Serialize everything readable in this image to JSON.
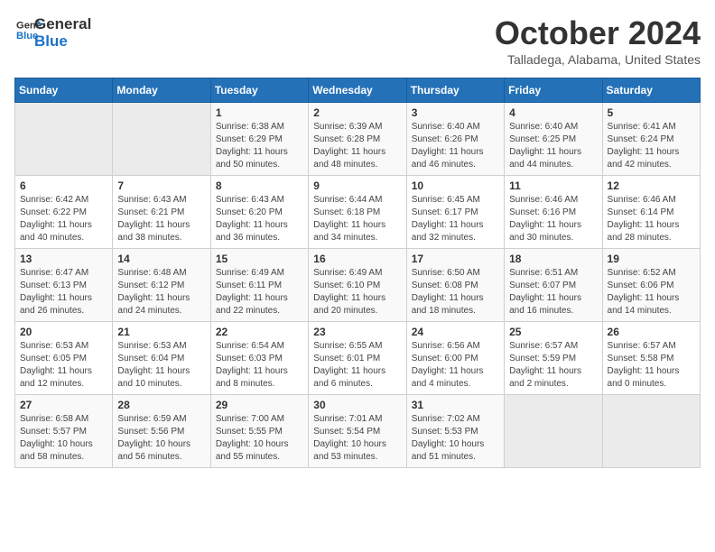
{
  "logo": {
    "line1": "General",
    "line2": "Blue"
  },
  "title": "October 2024",
  "location": "Talladega, Alabama, United States",
  "days_of_week": [
    "Sunday",
    "Monday",
    "Tuesday",
    "Wednesday",
    "Thursday",
    "Friday",
    "Saturday"
  ],
  "weeks": [
    [
      {
        "day": "",
        "sunrise": "",
        "sunset": "",
        "daylight": ""
      },
      {
        "day": "",
        "sunrise": "",
        "sunset": "",
        "daylight": ""
      },
      {
        "day": "1",
        "sunrise": "Sunrise: 6:38 AM",
        "sunset": "Sunset: 6:29 PM",
        "daylight": "Daylight: 11 hours and 50 minutes."
      },
      {
        "day": "2",
        "sunrise": "Sunrise: 6:39 AM",
        "sunset": "Sunset: 6:28 PM",
        "daylight": "Daylight: 11 hours and 48 minutes."
      },
      {
        "day": "3",
        "sunrise": "Sunrise: 6:40 AM",
        "sunset": "Sunset: 6:26 PM",
        "daylight": "Daylight: 11 hours and 46 minutes."
      },
      {
        "day": "4",
        "sunrise": "Sunrise: 6:40 AM",
        "sunset": "Sunset: 6:25 PM",
        "daylight": "Daylight: 11 hours and 44 minutes."
      },
      {
        "day": "5",
        "sunrise": "Sunrise: 6:41 AM",
        "sunset": "Sunset: 6:24 PM",
        "daylight": "Daylight: 11 hours and 42 minutes."
      }
    ],
    [
      {
        "day": "6",
        "sunrise": "Sunrise: 6:42 AM",
        "sunset": "Sunset: 6:22 PM",
        "daylight": "Daylight: 11 hours and 40 minutes."
      },
      {
        "day": "7",
        "sunrise": "Sunrise: 6:43 AM",
        "sunset": "Sunset: 6:21 PM",
        "daylight": "Daylight: 11 hours and 38 minutes."
      },
      {
        "day": "8",
        "sunrise": "Sunrise: 6:43 AM",
        "sunset": "Sunset: 6:20 PM",
        "daylight": "Daylight: 11 hours and 36 minutes."
      },
      {
        "day": "9",
        "sunrise": "Sunrise: 6:44 AM",
        "sunset": "Sunset: 6:18 PM",
        "daylight": "Daylight: 11 hours and 34 minutes."
      },
      {
        "day": "10",
        "sunrise": "Sunrise: 6:45 AM",
        "sunset": "Sunset: 6:17 PM",
        "daylight": "Daylight: 11 hours and 32 minutes."
      },
      {
        "day": "11",
        "sunrise": "Sunrise: 6:46 AM",
        "sunset": "Sunset: 6:16 PM",
        "daylight": "Daylight: 11 hours and 30 minutes."
      },
      {
        "day": "12",
        "sunrise": "Sunrise: 6:46 AM",
        "sunset": "Sunset: 6:14 PM",
        "daylight": "Daylight: 11 hours and 28 minutes."
      }
    ],
    [
      {
        "day": "13",
        "sunrise": "Sunrise: 6:47 AM",
        "sunset": "Sunset: 6:13 PM",
        "daylight": "Daylight: 11 hours and 26 minutes."
      },
      {
        "day": "14",
        "sunrise": "Sunrise: 6:48 AM",
        "sunset": "Sunset: 6:12 PM",
        "daylight": "Daylight: 11 hours and 24 minutes."
      },
      {
        "day": "15",
        "sunrise": "Sunrise: 6:49 AM",
        "sunset": "Sunset: 6:11 PM",
        "daylight": "Daylight: 11 hours and 22 minutes."
      },
      {
        "day": "16",
        "sunrise": "Sunrise: 6:49 AM",
        "sunset": "Sunset: 6:10 PM",
        "daylight": "Daylight: 11 hours and 20 minutes."
      },
      {
        "day": "17",
        "sunrise": "Sunrise: 6:50 AM",
        "sunset": "Sunset: 6:08 PM",
        "daylight": "Daylight: 11 hours and 18 minutes."
      },
      {
        "day": "18",
        "sunrise": "Sunrise: 6:51 AM",
        "sunset": "Sunset: 6:07 PM",
        "daylight": "Daylight: 11 hours and 16 minutes."
      },
      {
        "day": "19",
        "sunrise": "Sunrise: 6:52 AM",
        "sunset": "Sunset: 6:06 PM",
        "daylight": "Daylight: 11 hours and 14 minutes."
      }
    ],
    [
      {
        "day": "20",
        "sunrise": "Sunrise: 6:53 AM",
        "sunset": "Sunset: 6:05 PM",
        "daylight": "Daylight: 11 hours and 12 minutes."
      },
      {
        "day": "21",
        "sunrise": "Sunrise: 6:53 AM",
        "sunset": "Sunset: 6:04 PM",
        "daylight": "Daylight: 11 hours and 10 minutes."
      },
      {
        "day": "22",
        "sunrise": "Sunrise: 6:54 AM",
        "sunset": "Sunset: 6:03 PM",
        "daylight": "Daylight: 11 hours and 8 minutes."
      },
      {
        "day": "23",
        "sunrise": "Sunrise: 6:55 AM",
        "sunset": "Sunset: 6:01 PM",
        "daylight": "Daylight: 11 hours and 6 minutes."
      },
      {
        "day": "24",
        "sunrise": "Sunrise: 6:56 AM",
        "sunset": "Sunset: 6:00 PM",
        "daylight": "Daylight: 11 hours and 4 minutes."
      },
      {
        "day": "25",
        "sunrise": "Sunrise: 6:57 AM",
        "sunset": "Sunset: 5:59 PM",
        "daylight": "Daylight: 11 hours and 2 minutes."
      },
      {
        "day": "26",
        "sunrise": "Sunrise: 6:57 AM",
        "sunset": "Sunset: 5:58 PM",
        "daylight": "Daylight: 11 hours and 0 minutes."
      }
    ],
    [
      {
        "day": "27",
        "sunrise": "Sunrise: 6:58 AM",
        "sunset": "Sunset: 5:57 PM",
        "daylight": "Daylight: 10 hours and 58 minutes."
      },
      {
        "day": "28",
        "sunrise": "Sunrise: 6:59 AM",
        "sunset": "Sunset: 5:56 PM",
        "daylight": "Daylight: 10 hours and 56 minutes."
      },
      {
        "day": "29",
        "sunrise": "Sunrise: 7:00 AM",
        "sunset": "Sunset: 5:55 PM",
        "daylight": "Daylight: 10 hours and 55 minutes."
      },
      {
        "day": "30",
        "sunrise": "Sunrise: 7:01 AM",
        "sunset": "Sunset: 5:54 PM",
        "daylight": "Daylight: 10 hours and 53 minutes."
      },
      {
        "day": "31",
        "sunrise": "Sunrise: 7:02 AM",
        "sunset": "Sunset: 5:53 PM",
        "daylight": "Daylight: 10 hours and 51 minutes."
      },
      {
        "day": "",
        "sunrise": "",
        "sunset": "",
        "daylight": ""
      },
      {
        "day": "",
        "sunrise": "",
        "sunset": "",
        "daylight": ""
      }
    ]
  ]
}
